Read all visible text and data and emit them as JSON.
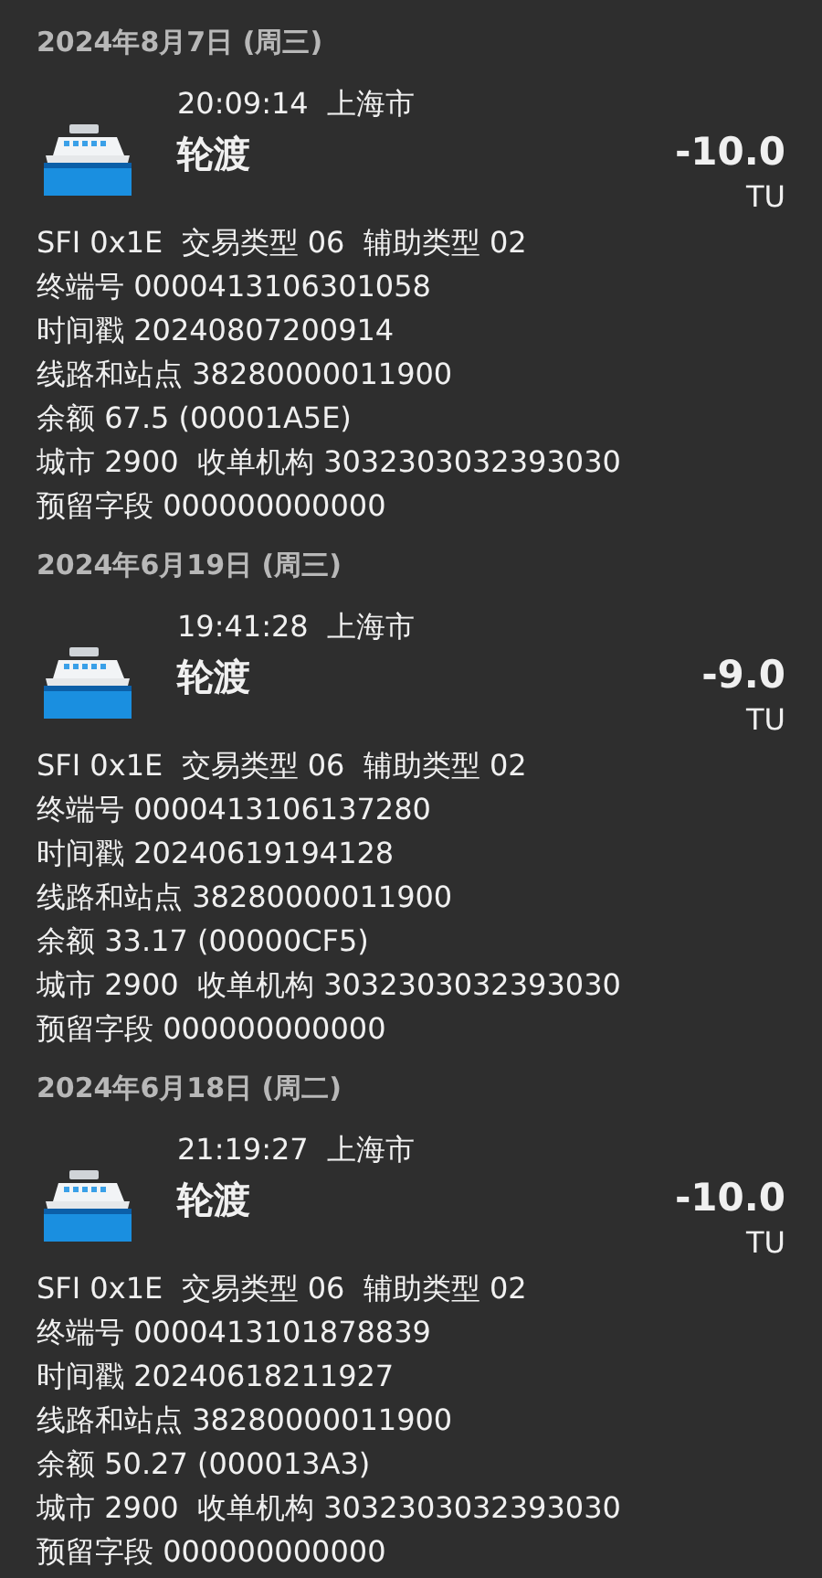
{
  "records": [
    {
      "date": "2024年8月7日 (周三)",
      "time": "20:09:14",
      "city": "上海市",
      "title": "轮渡",
      "amount": "-10.0",
      "unit": "TU",
      "details": [
        "SFI 0x1E  交易类型 06  辅助类型 02",
        "终端号 0000413106301058",
        "时间戳 20240807200914",
        "线路和站点 38280000011900",
        "余额 67.5 (00001A5E)",
        "城市 2900  收单机构 3032303032393030",
        "预留字段 000000000000"
      ]
    },
    {
      "date": "2024年6月19日 (周三)",
      "time": "19:41:28",
      "city": "上海市",
      "title": "轮渡",
      "amount": "-9.0",
      "unit": "TU",
      "details": [
        "SFI 0x1E  交易类型 06  辅助类型 02",
        "终端号 0000413106137280",
        "时间戳 20240619194128",
        "线路和站点 38280000011900",
        "余额 33.17 (00000CF5)",
        "城市 2900  收单机构 3032303032393030",
        "预留字段 000000000000"
      ]
    },
    {
      "date": "2024年6月18日 (周二)",
      "time": "21:19:27",
      "city": "上海市",
      "title": "轮渡",
      "amount": "-10.0",
      "unit": "TU",
      "details": [
        "SFI 0x1E  交易类型 06  辅助类型 02",
        "终端号 0000413101878839",
        "时间戳 20240618211927",
        "线路和站点 38280000011900",
        "余额 50.27 (000013A3)",
        "城市 2900  收单机构 3032303032393030",
        "预留字段 000000000000"
      ]
    }
  ]
}
